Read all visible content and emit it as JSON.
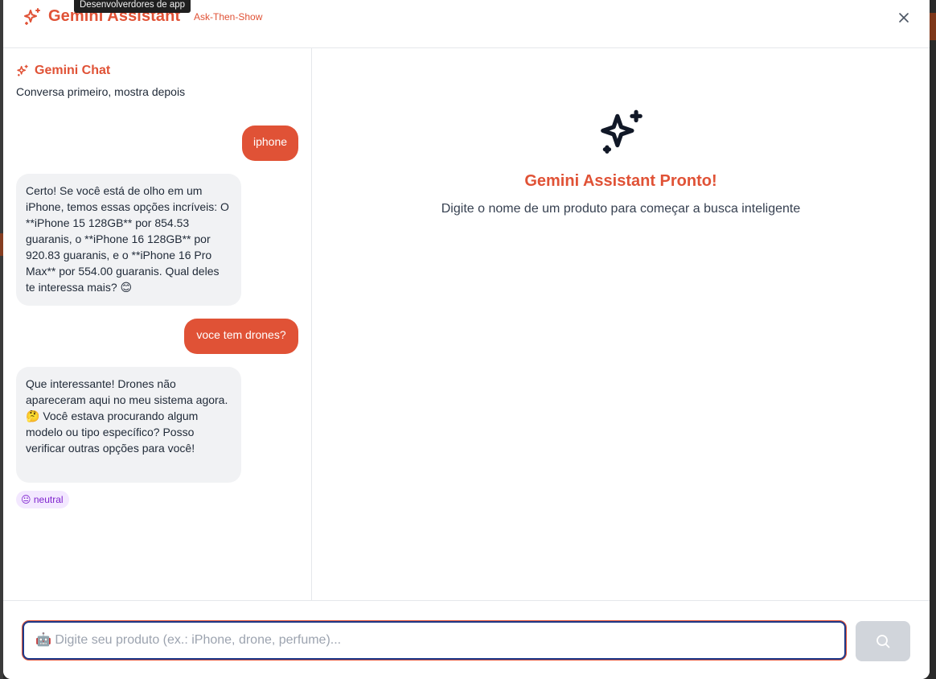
{
  "tooltip": "Desenvolverdores de app",
  "header": {
    "title": "Gemini Assistant",
    "subtitle": "Ask-Then-Show",
    "brand_icon": "sparkles-icon",
    "close_icon": "close-icon"
  },
  "chat": {
    "title": "Gemini Chat",
    "subtitle": "Conversa primeiro, mostra depois",
    "messages": [
      {
        "role": "user",
        "text": "iphone"
      },
      {
        "role": "assistant",
        "text": "Certo! Se você está de olho em um iPhone, temos essas opções incríveis: O **iPhone 15 128GB** por 854.53 guaranis, o **iPhone 16 128GB** por 920.83 guaranis, e o **iPhone 16 Pro Max** por 554.00 guaranis. Qual deles te interessa mais? 😊"
      },
      {
        "role": "user",
        "text": "voce tem drones?"
      },
      {
        "role": "assistant",
        "text": "Que interessante! Drones não apareceram aqui no meu sistema agora. 🤔 Você estava procurando algum modelo ou tipo específico? Posso verificar outras opções para você!"
      }
    ],
    "mood_badge": "😐 neutral"
  },
  "results": {
    "title": "Gemini Assistant Pronto!",
    "subtitle": "Digite o nome de um produto para começar a busca inteligente",
    "icon": "sparkles-icon"
  },
  "search": {
    "placeholder": "🤖 Digite seu produto (ex.: iPhone, drone, perfume)...",
    "value": "",
    "button_icon": "search-icon"
  },
  "colors": {
    "accent": "#e05236",
    "focus_ring": "#1e3a8a",
    "badge_bg": "#f3e8ff",
    "badge_text": "#7e22ce",
    "bot_bubble": "#f1f2f4",
    "button_disabled": "#d1d5db"
  }
}
